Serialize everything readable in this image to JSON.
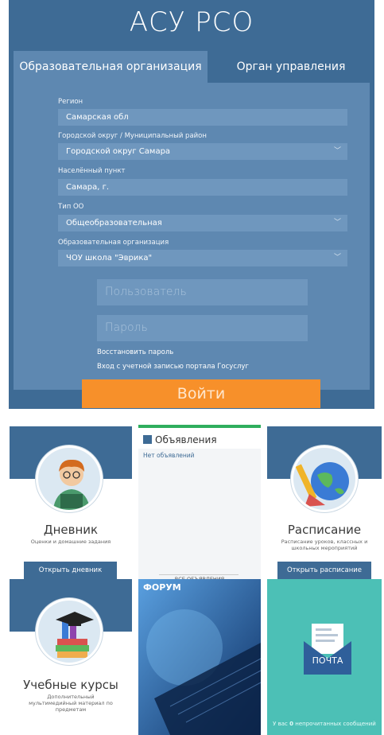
{
  "app": {
    "title": "АСУ РСО"
  },
  "tabs": [
    {
      "label": "Образовательная организация",
      "active": true
    },
    {
      "label": "Орган управления",
      "active": false
    }
  ],
  "form": {
    "region": {
      "label": "Регион",
      "value": "Самарская обл"
    },
    "district": {
      "label": "Городской округ / Муниципальный район",
      "value": "Городской округ Самара"
    },
    "locality": {
      "label": "Населённый пункт",
      "value": "Самара, г."
    },
    "school_type": {
      "label": "Тип ОО",
      "value": "Общеобразовательная"
    },
    "school": {
      "label": "Образовательная организация",
      "value": "ЧОУ школа \"Эврика\""
    },
    "user_placeholder": "Пользователь",
    "password_placeholder": "Пароль",
    "restore_link": "Восстановить пароль",
    "gosuslugi_link": "Вход с учетной записью портала Госуслуг",
    "login_button": "Войти"
  },
  "tiles": {
    "diary": {
      "title": "Дневник",
      "subtitle": "Оценки и домашние задания",
      "button": "Открыть дневник"
    },
    "announcements": {
      "title": "Объявления",
      "empty_text": "Нет объявлений",
      "all_link": "ВСЕ ОБЪЯВЛЕНИЯ"
    },
    "schedule": {
      "title": "Расписание",
      "subtitle": "Расписание уроков, классных и школьных мероприятий",
      "button": "Открыть расписание"
    },
    "courses": {
      "title": "Учебные курсы",
      "subtitle": "Дополнительный мультимедийный материал по предметам"
    },
    "forum": {
      "title": "ФОРУМ"
    },
    "mail": {
      "title": "ПОЧТА",
      "unread_prefix": "У вас",
      "unread_count": "0",
      "unread_suffix": "непрочитанных сообщений"
    }
  },
  "colors": {
    "primary": "#3e6b95",
    "form_bg": "#5e88b1",
    "field_bg": "#6f97be",
    "accent": "#f7902a",
    "mail_bg": "#4cc0b6"
  }
}
